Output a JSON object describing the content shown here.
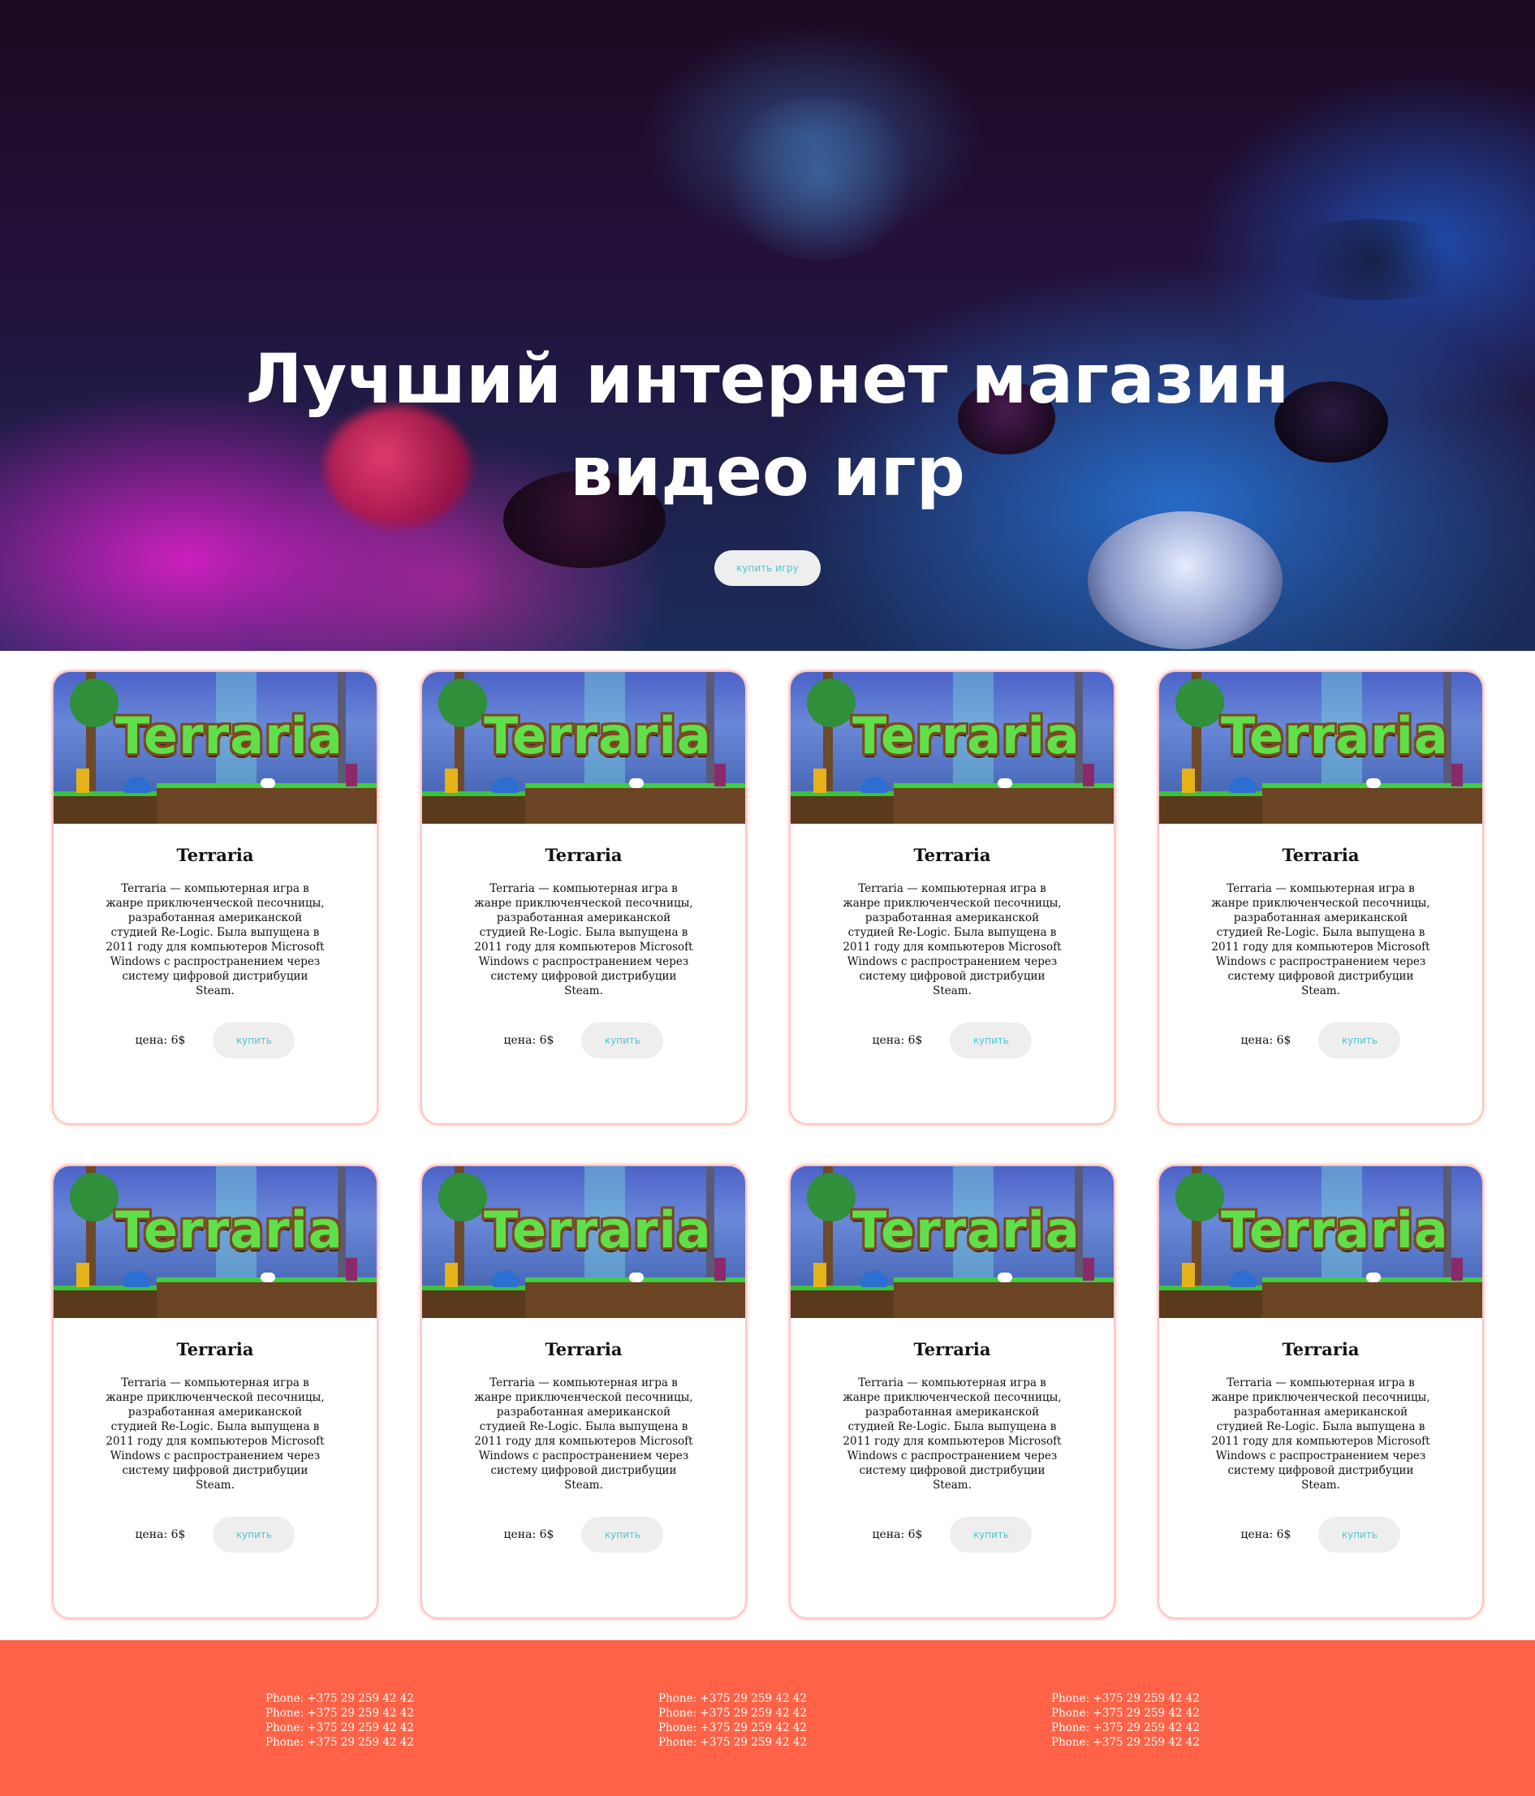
{
  "hero": {
    "title_line1": "Лучший интернет магазин",
    "title_line2": "видео игр",
    "button_label": "купить игру"
  },
  "cards": [
    {
      "image_text": "Terraria",
      "title": "Terraria",
      "description": "Terraria — компьютерная игра в жанре приключенческой песочницы, разработанная американской студией Re-Logic. Была выпущена в 2011 году для компьютеров Microsoft Windows с распространением через систему цифровой дистрибуции Steam.",
      "price": "цена: 6$",
      "buy_label": "купить"
    },
    {
      "image_text": "Terraria",
      "title": "Terraria",
      "description": "Terraria — компьютерная игра в жанре приключенческой песочницы, разработанная американской студией Re-Logic. Была выпущена в 2011 году для компьютеров Microsoft Windows с распространением через систему цифровой дистрибуции Steam.",
      "price": "цена: 6$",
      "buy_label": "купить"
    },
    {
      "image_text": "Terraria",
      "title": "Terraria",
      "description": "Terraria — компьютерная игра в жанре приключенческой песочницы, разработанная американской студией Re-Logic. Была выпущена в 2011 году для компьютеров Microsoft Windows с распространением через систему цифровой дистрибуции Steam.",
      "price": "цена: 6$",
      "buy_label": "купить"
    },
    {
      "image_text": "Terraria",
      "title": "Terraria",
      "description": "Terraria — компьютерная игра в жанре приключенческой песочницы, разработанная американской студией Re-Logic. Была выпущена в 2011 году для компьютеров Microsoft Windows с распространением через систему цифровой дистрибуции Steam.",
      "price": "цена: 6$",
      "buy_label": "купить"
    },
    {
      "image_text": "Terraria",
      "title": "Terraria",
      "description": "Terraria — компьютерная игра в жанре приключенческой песочницы, разработанная американской студией Re-Logic. Была выпущена в 2011 году для компьютеров Microsoft Windows с распространением через систему цифровой дистрибуции Steam.",
      "price": "цена: 6$",
      "buy_label": "купить"
    },
    {
      "image_text": "Terraria",
      "title": "Terraria",
      "description": "Terraria — компьютерная игра в жанре приключенческой песочницы, разработанная американской студией Re-Logic. Была выпущена в 2011 году для компьютеров Microsoft Windows с распространением через систему цифровой дистрибуции Steam.",
      "price": "цена: 6$",
      "buy_label": "купить"
    },
    {
      "image_text": "Terraria",
      "title": "Terraria",
      "description": "Terraria — компьютерная игра в жанре приключенческой песочницы, разработанная американской студией Re-Logic. Была выпущена в 2011 году для компьютеров Microsoft Windows с распространением через систему цифровой дистрибуции Steam.",
      "price": "цена: 6$",
      "buy_label": "купить"
    },
    {
      "image_text": "Terraria",
      "title": "Terraria",
      "description": "Terraria — компьютерная игра в жанре приключенческой песочницы, разработанная американской студией Re-Logic. Была выпущена в 2011 году для компьютеров Microsoft Windows с распространением через систему цифровой дистрибуции Steam.",
      "price": "цена: 6$",
      "buy_label": "купить"
    }
  ],
  "footer": {
    "columns": [
      [
        "Phone: +375 29 259 42 42",
        "Phone: +375 29 259 42 42",
        "Phone: +375 29 259 42 42",
        "Phone: +375 29 259 42 42"
      ],
      [
        "Phone: +375 29 259 42 42",
        "Phone: +375 29 259 42 42",
        "Phone: +375 29 259 42 42",
        "Phone: +375 29 259 42 42"
      ],
      [
        "Phone: +375 29 259 42 42",
        "Phone: +375 29 259 42 42",
        "Phone: +375 29 259 42 42",
        "Phone: +375 29 259 42 42"
      ]
    ]
  },
  "colors": {
    "footer_bg": "#ff6347",
    "button_bg": "#eeeeee",
    "button_text": "#52c4cc",
    "card_border": "#ffc4c4"
  }
}
